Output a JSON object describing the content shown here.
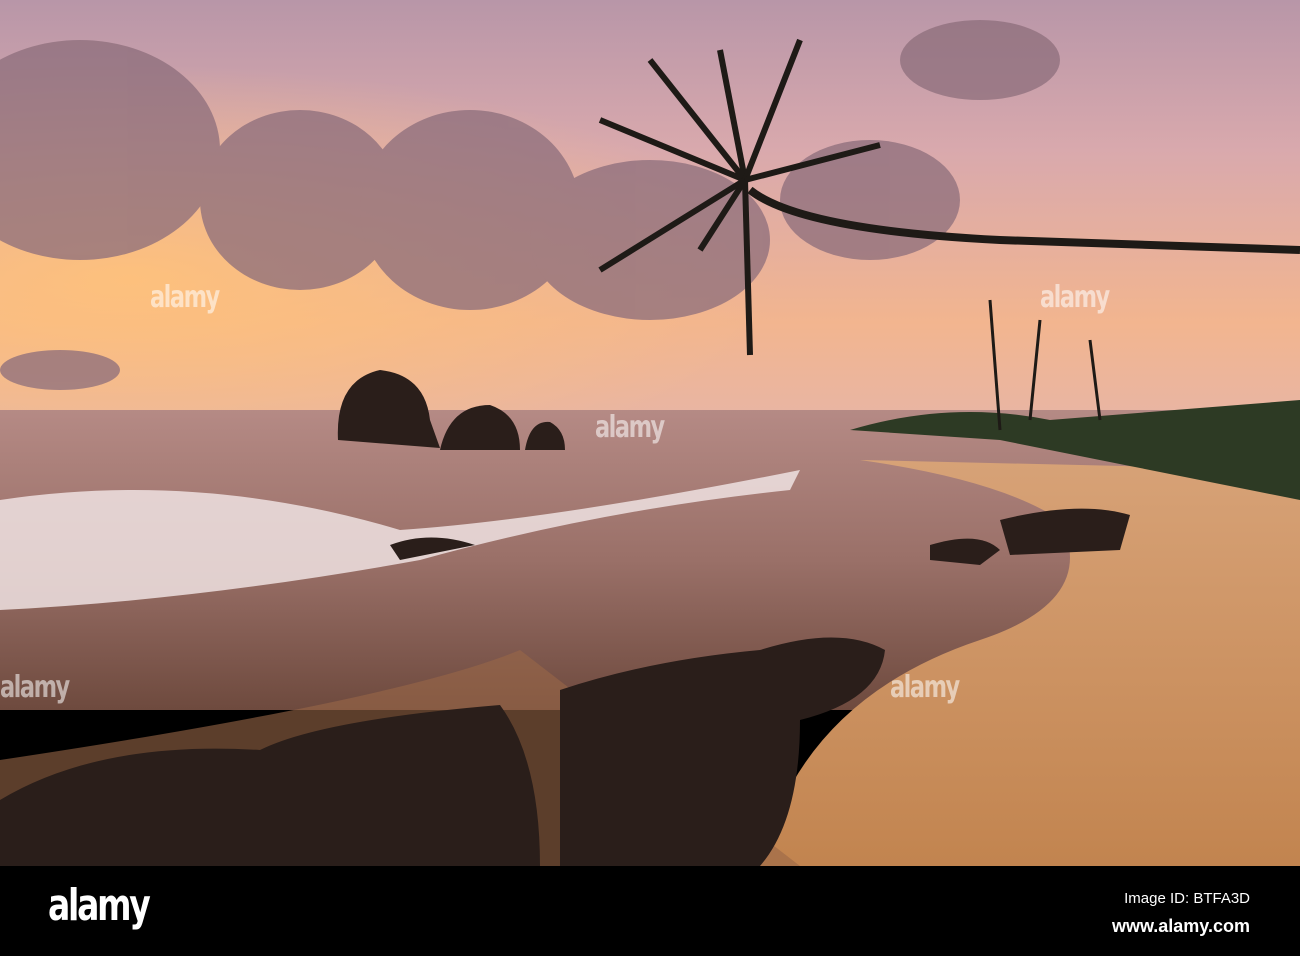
{
  "image": {
    "subject": "Sunset beach with leaning palm tree",
    "colors": {
      "sky_top": "#c9a6b9",
      "sky_glow": "#f4b48a",
      "sea": "#8a6a67",
      "sand": "#d19a67",
      "rock": "#2a1e1a"
    }
  },
  "watermark": {
    "text": "alamy"
  },
  "footer": {
    "logo": "alamy",
    "image_id": "Image ID: BTFA3D",
    "url": "www.alamy.com"
  }
}
